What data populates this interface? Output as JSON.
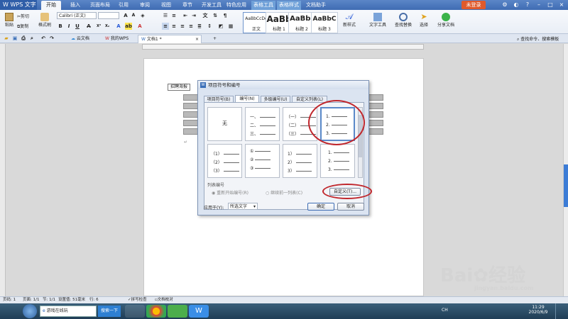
{
  "titlebar": {
    "app_name": "WPS 文字",
    "menu_tabs": [
      "开始",
      "插入",
      "页面布局",
      "引用",
      "审阅",
      "视图",
      "章节",
      "开发工具",
      "特色应用",
      "表格工具",
      "表格样式",
      "文档助手"
    ],
    "login_label": "未登录"
  },
  "ribbon": {
    "paste_label": "粘贴",
    "cut_label": "剪切",
    "copy_label": "复制",
    "format_painter_label": "格式刷",
    "font_name": "Calibri (正文)",
    "font_size": "",
    "styles": [
      {
        "preview": "AaBbCcDd",
        "label": "正文"
      },
      {
        "preview": "AaBb",
        "label": "标题 1"
      },
      {
        "preview": "AaBb(",
        "label": "标题 2"
      },
      {
        "preview": "AaBbC",
        "label": "标题 3"
      }
    ],
    "new_style_label": "新样式",
    "text_tools_label": "文字工具",
    "find_replace_label": "查找替换",
    "select_label": "选择",
    "share_label": "分享文档",
    "search_placeholder": "查找命令、搜索模板"
  },
  "doctabs": {
    "tabs": [
      "云文档",
      "我的WPS",
      "文档1 *"
    ],
    "add": "+"
  },
  "document": {
    "cell_label": "招聘海报"
  },
  "dialog": {
    "title": "项目符号和编号",
    "tabs": [
      "项目符号(B)",
      "编号(N)",
      "多级编号(U)",
      "自定义列表(L)"
    ],
    "none_label": "无",
    "cells": [
      {
        "lines": [
          "一、",
          "二、",
          "三、"
        ]
      },
      {
        "lines": [
          "（一）",
          "（二）",
          "（三）"
        ]
      },
      {
        "lines": [
          "1.",
          "2.",
          "3."
        ]
      },
      {
        "lines": [
          "（1）",
          "（2）",
          "（3）"
        ]
      },
      {
        "lines": [
          "①",
          "②",
          "③"
        ]
      },
      {
        "lines": [
          "1）",
          "2）",
          "3）"
        ]
      },
      {
        "lines": [
          "1.",
          "2.",
          "3."
        ]
      }
    ],
    "list_numbering_label": "列表编号",
    "restart_label": "重新开始编号(R)",
    "continue_label": "继续前一列表(C)",
    "customize_label": "自定义(T)...",
    "apply_to_label": "应用于(Y):",
    "apply_to_value": "所选文字",
    "ok_label": "确定",
    "cancel_label": "取消"
  },
  "statusbar": {
    "items": [
      "页码: 1",
      "页面: 1/1",
      "节: 1/1",
      "设置值: 51毫米",
      "行: 6"
    ],
    "spell_check": "拼写检查",
    "doc_check": "文档校对"
  },
  "taskbar": {
    "ie_label": "游戏在线玩",
    "search_button": "搜索一下",
    "lang": "CH",
    "time": "11:29",
    "date": "2020/6/9"
  },
  "watermark": {
    "brand": "Bai",
    "brand2": "经验",
    "url": "jingyan.baidu.com"
  }
}
